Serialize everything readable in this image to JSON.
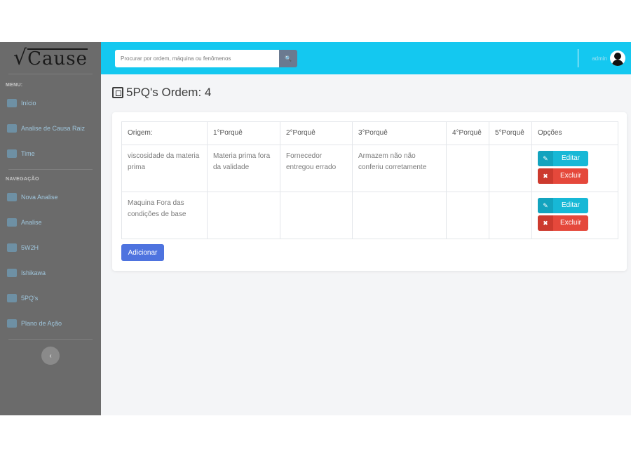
{
  "logo": {
    "sqrt": "√",
    "word": "Cause"
  },
  "sidebar": {
    "menu_heading": "MENU:",
    "nav_heading": "NAVEGAÇÃO",
    "menu_items": [
      {
        "label": "Início"
      },
      {
        "label": "Analise de Causa Raiz"
      },
      {
        "label": "Time"
      }
    ],
    "nav_items": [
      {
        "label": "Nova Analise"
      },
      {
        "label": "Analise"
      },
      {
        "label": "5W2H"
      },
      {
        "label": "Ishikawa"
      },
      {
        "label": "5PQ's"
      },
      {
        "label": "Plano de Ação"
      }
    ],
    "toggle": "‹"
  },
  "topbar": {
    "search_placeholder": "Procurar por ordem, máquina ou fenômenos",
    "search_icon": "🔍",
    "user_name": "admin"
  },
  "page": {
    "title": "5PQ's Ordem: 4"
  },
  "table": {
    "headers": [
      "Origem:",
      "1°Porquê",
      "2°Porquê",
      "3°Porquê",
      "4°Porquê",
      "5°Porquê",
      "Opções"
    ],
    "rows": [
      {
        "origem": "viscosidade da materia prima",
        "p1": "Materia prima fora da validade",
        "p2": "Fornecedor entregou errado",
        "p3": "Armazem não não conferiu corretamente",
        "p4": "",
        "p5": ""
      },
      {
        "origem": "Maquina Fora das condições de base",
        "p1": "",
        "p2": "",
        "p3": "",
        "p4": "",
        "p5": ""
      }
    ],
    "edit_label": "Editar",
    "delete_label": "Excluir",
    "edit_icon": "✎",
    "delete_icon": "✖"
  },
  "add_label": "Adicionar",
  "colors": {
    "topbar": "#14c8f0",
    "sidebar": "#6b6b6b",
    "edit": "#17b8d6",
    "delete": "#e5483b",
    "primary": "#4e73df"
  }
}
